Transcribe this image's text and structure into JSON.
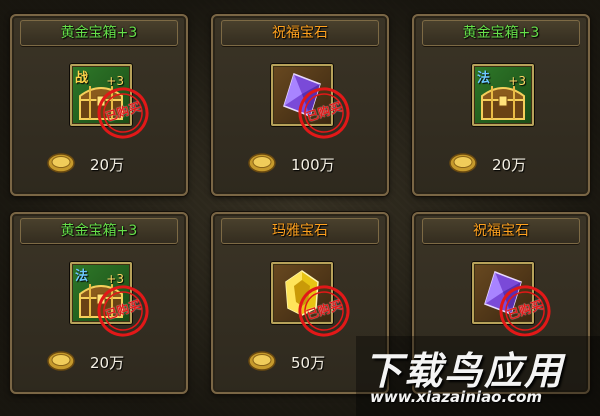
{
  "shop_items": [
    {
      "title": "黄金宝箱+3",
      "title_color": "green",
      "slot": "green",
      "icon": "treasure-chest-icon",
      "class_tag": "战",
      "class_type": "warrior",
      "plus": "+3",
      "stamp": "已购买",
      "price": "20万"
    },
    {
      "title": "祝福宝石",
      "title_color": "orange",
      "slot": "brown",
      "icon": "purple-gem-icon",
      "class_tag": "",
      "class_type": "",
      "plus": "",
      "stamp": "已购买",
      "price": "100万"
    },
    {
      "title": "黄金宝箱+3",
      "title_color": "green",
      "slot": "green",
      "icon": "treasure-chest-icon",
      "class_tag": "法",
      "class_type": "mage",
      "plus": "+3",
      "stamp": "已购买",
      "price": "20万"
    },
    {
      "title": "黄金宝箱+3",
      "title_color": "green",
      "slot": "green",
      "icon": "treasure-chest-icon",
      "class_tag": "法",
      "class_type": "mage",
      "plus": "+3",
      "stamp": "已购买",
      "price": "20万"
    },
    {
      "title": "玛雅宝石",
      "title_color": "orange",
      "slot": "brown",
      "icon": "yellow-gem-icon",
      "class_tag": "",
      "class_type": "",
      "plus": "",
      "stamp": "已购买",
      "price": "50万"
    },
    {
      "title": "祝福宝石",
      "title_color": "orange",
      "slot": "brown",
      "icon": "purple-gem-icon",
      "class_tag": "",
      "class_type": "",
      "plus": "",
      "stamp": "已购买",
      "price": ""
    }
  ],
  "watermark": {
    "main": "下载鸟应用",
    "url": "www.xiazainiao.com"
  },
  "colors": {
    "green_title": "#67e04a",
    "orange_title": "#ffa21f",
    "stamp_red": "#e21818"
  }
}
